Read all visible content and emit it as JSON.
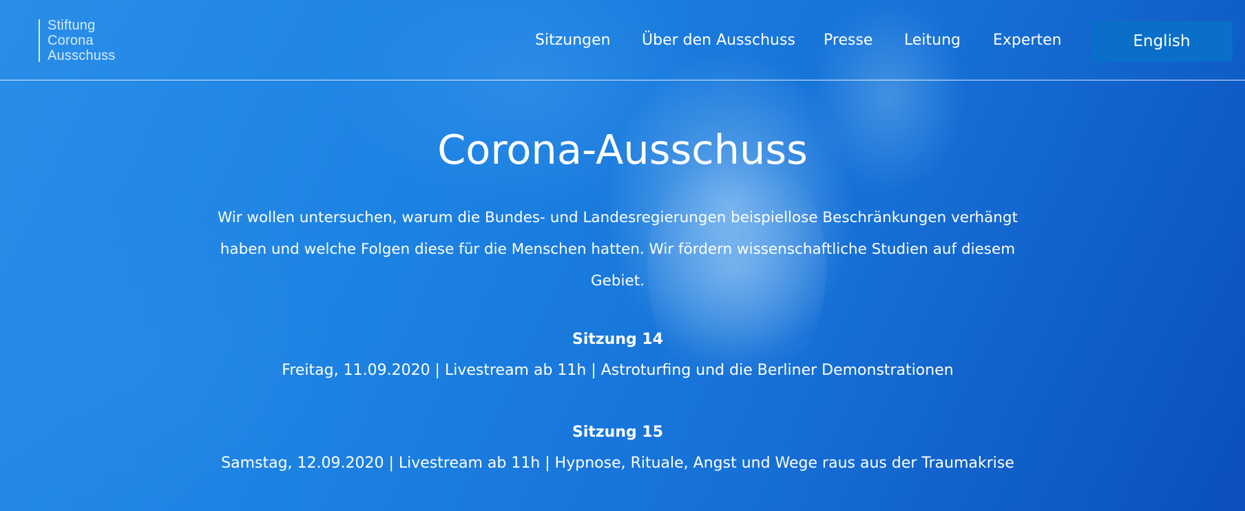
{
  "logo": {
    "lines": [
      "Stiftung",
      "Corona",
      "Ausschuss"
    ]
  },
  "nav": {
    "items": [
      "Sitzungen",
      "Über den Ausschuss",
      "Presse",
      "Leitung",
      "Experten"
    ],
    "language_button": "English"
  },
  "main": {
    "title": "Corona-Ausschuss",
    "intro": "Wir wollen untersuchen, warum die Bundes- und Landesregierungen beispiellose Beschränkungen verhängt haben und welche Folgen diese für die Menschen hatten. Wir fördern wissenschaftliche Studien auf diesem Gebiet.",
    "sessions": [
      {
        "title": "Sitzung 14",
        "details": "Freitag, 11.09.2020 | Livestream ab 11h | Astroturfing und die Berliner Demonstrationen"
      },
      {
        "title": "Sitzung 15",
        "details": "Samstag, 12.09.2020 | Livestream ab 11h | Hypnose, Rituale, Angst und Wege raus aus der Traumakrise"
      }
    ]
  },
  "colors": {
    "background": "#1b7ee0",
    "button": "#0a6fc8",
    "text": "#ffffff"
  }
}
